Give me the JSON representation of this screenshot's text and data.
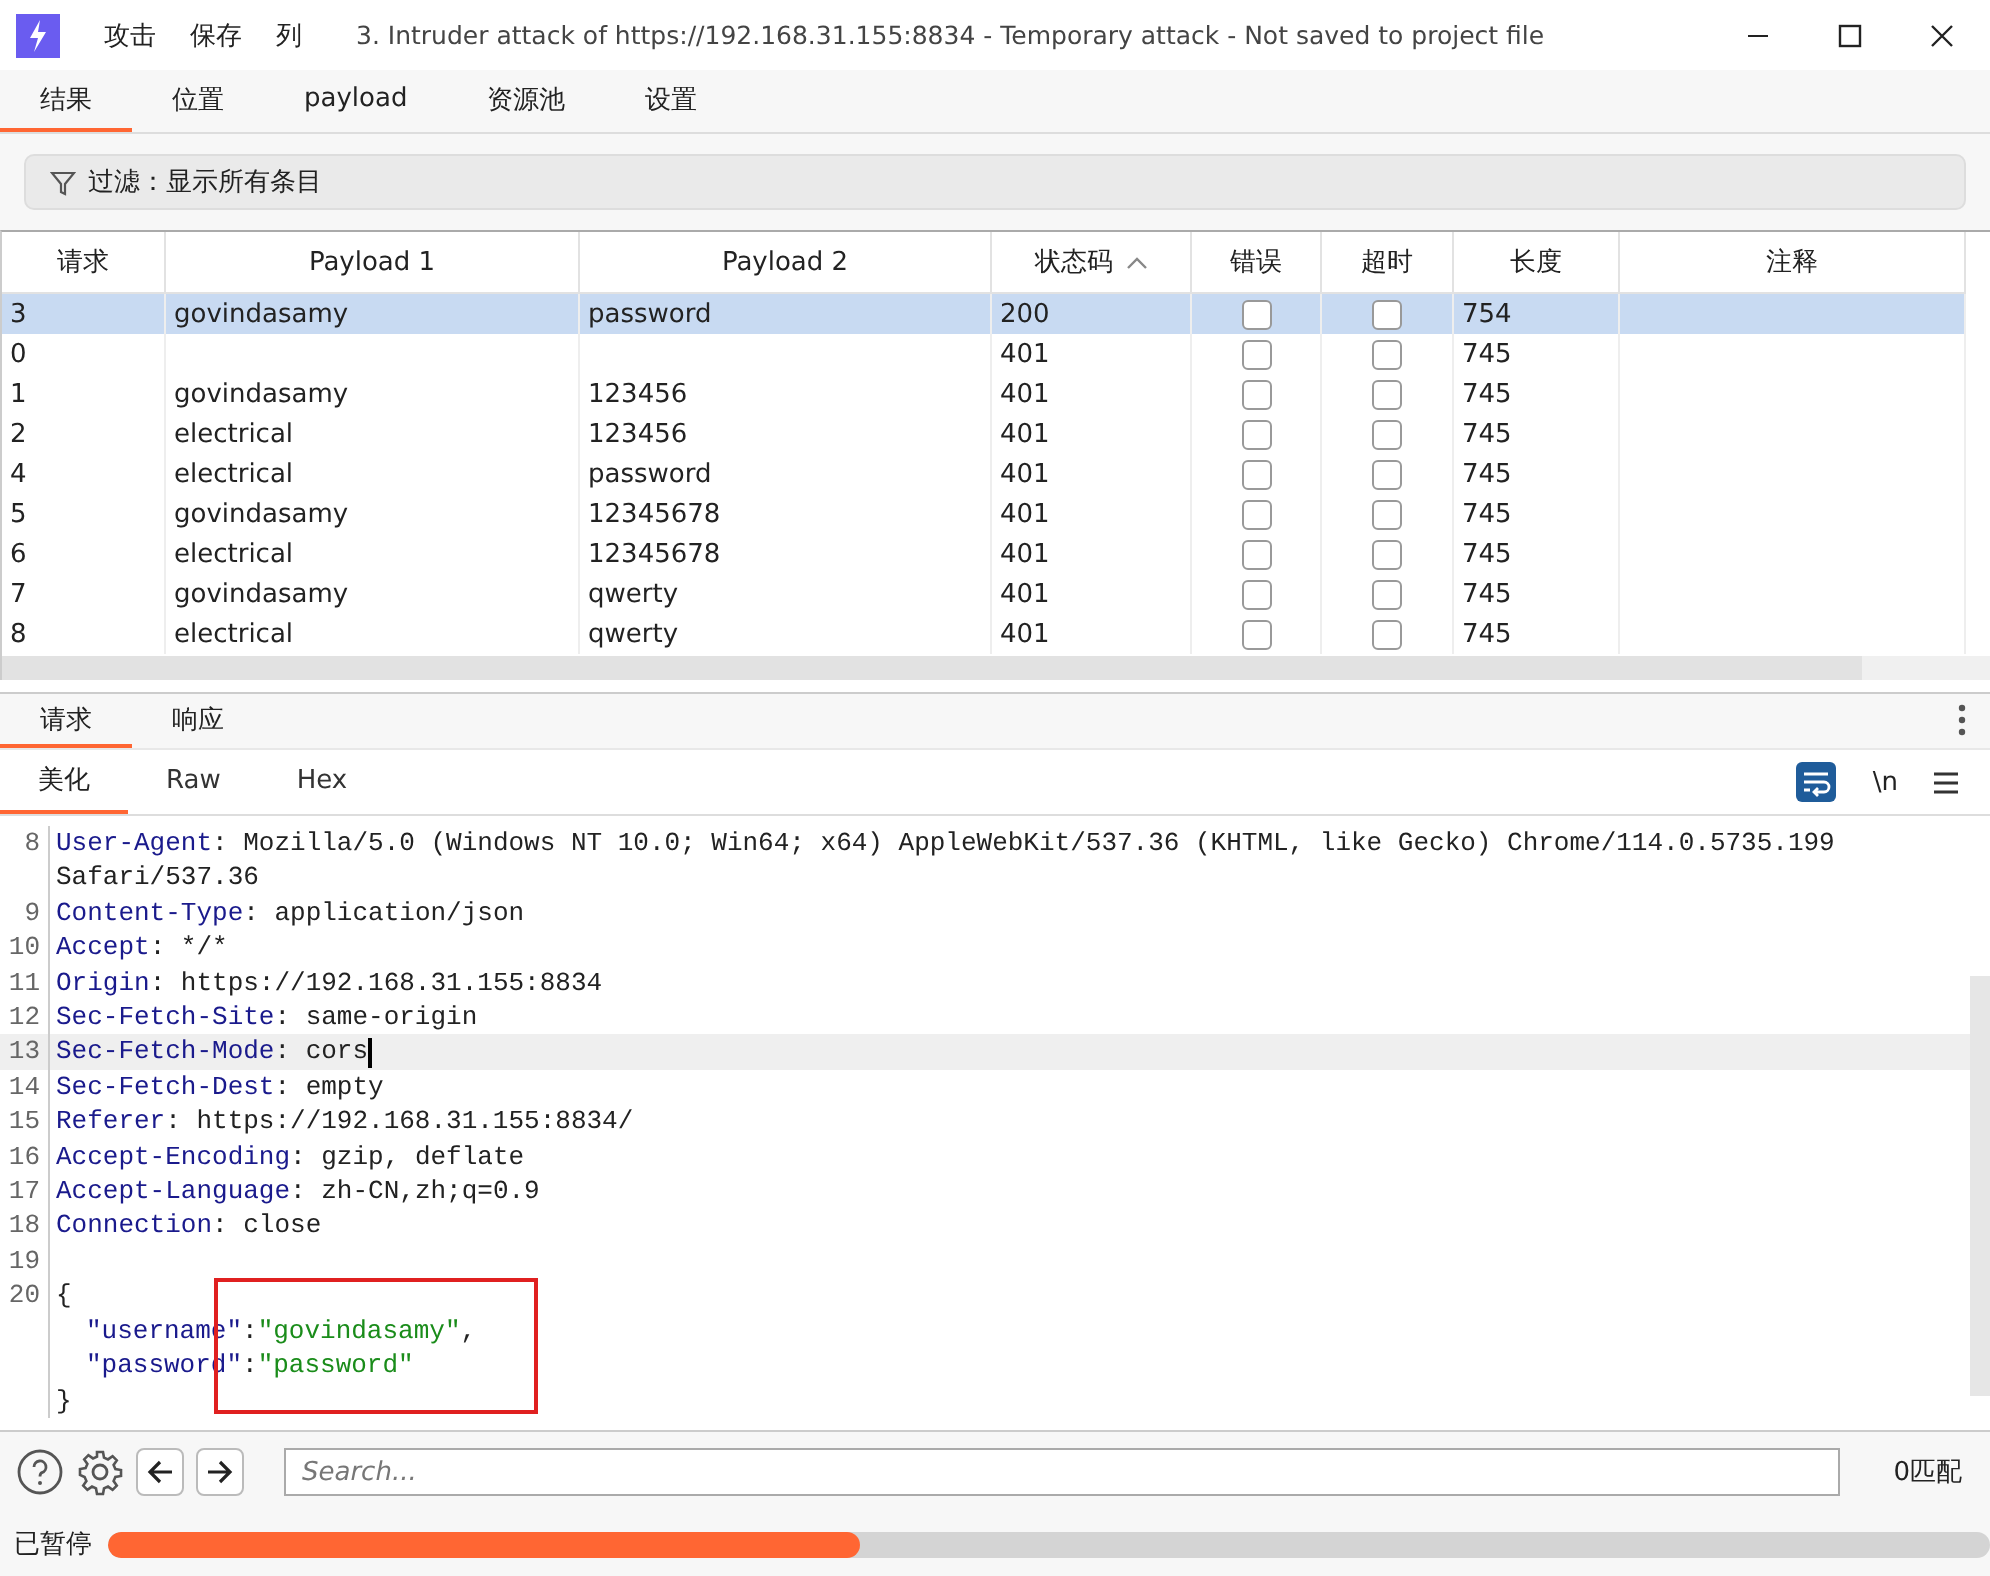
{
  "window": {
    "title": "3. Intruder attack of https://192.168.31.155:8834 - Temporary attack - Not saved to project file",
    "menu": [
      "攻击",
      "保存",
      "列"
    ]
  },
  "tabs": [
    {
      "label": "结果",
      "selected": true
    },
    {
      "label": "位置",
      "selected": false
    },
    {
      "label": "payload",
      "selected": false
    },
    {
      "label": "资源池",
      "selected": false
    },
    {
      "label": "设置",
      "selected": false
    }
  ],
  "filter": {
    "label": "过滤：显示所有条目"
  },
  "table": {
    "columns": [
      {
        "label": "请求",
        "sorted": false
      },
      {
        "label": "Payload 1",
        "sorted": false
      },
      {
        "label": "Payload 2",
        "sorted": false
      },
      {
        "label": "状态码",
        "sorted": true
      },
      {
        "label": "错误",
        "sorted": false
      },
      {
        "label": "超时",
        "sorted": false
      },
      {
        "label": "长度",
        "sorted": false
      },
      {
        "label": "注释",
        "sorted": false
      }
    ],
    "rows": [
      {
        "request": "3",
        "payload1": "govindasamy",
        "payload2": "password",
        "status": "200",
        "error": false,
        "timeout": false,
        "length": "754",
        "selected": true
      },
      {
        "request": "0",
        "status": "401",
        "error": false,
        "timeout": false,
        "length": "745",
        "selected": false
      },
      {
        "request": "1",
        "payload1": "govindasamy",
        "payload2": "123456",
        "status": "401",
        "error": false,
        "timeout": false,
        "length": "745",
        "selected": false
      },
      {
        "request": "2",
        "payload1": "electrical",
        "payload2": "123456",
        "status": "401",
        "error": false,
        "timeout": false,
        "length": "745",
        "selected": false
      },
      {
        "request": "4",
        "payload1": "electrical",
        "payload2": "password",
        "status": "401",
        "error": false,
        "timeout": false,
        "length": "745",
        "selected": false
      },
      {
        "request": "5",
        "payload1": "govindasamy",
        "payload2": "12345678",
        "status": "401",
        "error": false,
        "timeout": false,
        "length": "745",
        "selected": false
      },
      {
        "request": "6",
        "payload1": "electrical",
        "payload2": "12345678",
        "status": "401",
        "error": false,
        "timeout": false,
        "length": "745",
        "selected": false
      },
      {
        "request": "7",
        "payload1": "govindasamy",
        "payload2": "qwerty",
        "status": "401",
        "error": false,
        "timeout": false,
        "length": "745",
        "selected": false
      },
      {
        "request": "8",
        "payload1": "electrical",
        "payload2": "qwerty",
        "status": "401",
        "error": false,
        "timeout": false,
        "length": "745",
        "selected": false
      }
    ]
  },
  "message_tabs": [
    {
      "label": "请求",
      "selected": true
    },
    {
      "label": "响应",
      "selected": false
    }
  ],
  "view_tabs": [
    {
      "label": "美化",
      "selected": true
    },
    {
      "label": "Raw",
      "selected": false
    },
    {
      "label": "Hex",
      "selected": false
    }
  ],
  "view_options": {
    "wrap_on": true,
    "newline_label": "\\n"
  },
  "editor": {
    "lines": [
      {
        "num": "8",
        "kind": "header",
        "key": "User-Agent",
        "sep": ":",
        "value": "Mozilla/5.0 (Windows NT 10.0; Win64; x64) AppleWebKit/537.36 (KHTML, like Gecko) Chrome/114.0.5735.199 Safari/537.36",
        "selected": false
      },
      {
        "num": "9",
        "kind": "header",
        "key": "Content-Type",
        "sep": ":",
        "value": "application/json",
        "selected": false
      },
      {
        "num": "10",
        "kind": "header",
        "key": "Accept",
        "sep": ":",
        "value": "*/*",
        "selected": false
      },
      {
        "num": "11",
        "kind": "header",
        "key": "Origin",
        "sep": ":",
        "value": "https://192.168.31.155:8834",
        "selected": false
      },
      {
        "num": "12",
        "kind": "header",
        "key": "Sec-Fetch-Site",
        "sep": ":",
        "value": "same-origin",
        "selected": false
      },
      {
        "num": "13",
        "kind": "header",
        "key": "Sec-Fetch-Mode",
        "sep": ":",
        "value": "cors",
        "selected": true
      },
      {
        "num": "14",
        "kind": "header",
        "key": "Sec-Fetch-Dest",
        "sep": ":",
        "value": "empty",
        "selected": false
      },
      {
        "num": "15",
        "kind": "header",
        "key": "Referer",
        "sep": ":",
        "value": "https://192.168.31.155:8834/",
        "selected": false
      },
      {
        "num": "16",
        "kind": "header",
        "key": "Accept-Encoding",
        "sep": ":",
        "value": "gzip, deflate",
        "selected": false
      },
      {
        "num": "17",
        "kind": "header",
        "key": "Accept-Language",
        "sep": ":",
        "value": "zh-CN,zh;q=0.9",
        "selected": false
      },
      {
        "num": "18",
        "kind": "header",
        "key": "Connection",
        "sep": ":",
        "value": "close",
        "selected": false
      },
      {
        "num": "19",
        "kind": "blank",
        "selected": false
      },
      {
        "num": "20",
        "kind": "plain",
        "text": "{",
        "selected": false
      },
      {
        "kind": "json",
        "key": "\"username\"",
        "sep": ":",
        "value": "\"govindasamy\"",
        "tail": ",",
        "selected": false
      },
      {
        "kind": "json",
        "key": "\"password\"",
        "sep": ":",
        "value": "\"password\"",
        "selected": false
      },
      {
        "kind": "plain",
        "text": "}",
        "selected": false
      }
    ]
  },
  "search": {
    "placeholder": "Search...",
    "matches": "0匹配"
  },
  "status": {
    "label": "已暂停",
    "level": 0.4
  }
}
